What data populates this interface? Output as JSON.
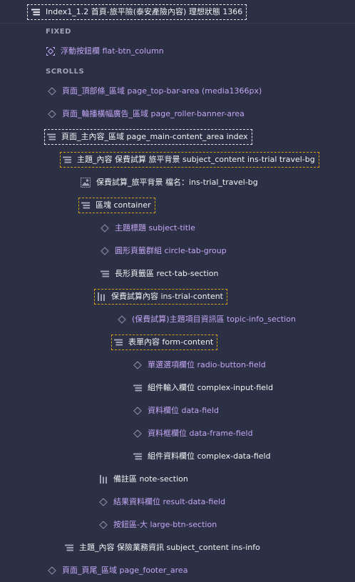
{
  "root": {
    "label": "Index1_1.2 首頁-旅平險(泰安產險內容) 理想狀態 1366"
  },
  "sections": {
    "fixed": "FIXED",
    "scrolls": "SCROLLS"
  },
  "layers": [
    {
      "label": "浮動按鈕欄 flat-btn_column",
      "icon": "frame-icon",
      "style": "purple"
    },
    {
      "label": "頁面_頂部條_區域 page_top-bar-area (media1366px)",
      "icon": "component-diamond-icon",
      "style": "purple"
    },
    {
      "label": "頁面_輪播橫幅廣告_區域 page_roller-banner-area",
      "icon": "component-diamond-icon",
      "style": "purple"
    },
    {
      "label": "頁面_主內容_區域 page_main-content_area index",
      "icon": "stack-vertical-icon",
      "style": "white"
    },
    {
      "label": "主題_內容 保費試算 旅平背景 subject_content ins-trial travel-bg",
      "icon": "stack-vertical-icon",
      "style": "white"
    },
    {
      "label": "保費試算_旅平背景 檔名：ins-trial_travel-bg",
      "icon": "image-icon",
      "style": "white"
    },
    {
      "label": "區塊 container",
      "icon": "stack-vertical-icon",
      "style": "white"
    },
    {
      "label": "主題標題 subject-title",
      "icon": "component-diamond-icon",
      "style": "purple"
    },
    {
      "label": "圓形頁籤群組 circle-tab-group",
      "icon": "component-diamond-icon",
      "style": "purple"
    },
    {
      "label": "長形頁籤區 rect-tab-section",
      "icon": "stack-vertical-icon",
      "style": "white"
    },
    {
      "label": "保費試算內容 ins-trial-content",
      "icon": "stack-horizontal-icon",
      "style": "white"
    },
    {
      "label": "(保費試算)主題項目資訊區 topic-info_section",
      "icon": "component-diamond-icon",
      "style": "purple"
    },
    {
      "label": "表單內容 form-content",
      "icon": "stack-vertical-icon",
      "style": "white"
    },
    {
      "label": "單選選項欄位 radio-button-field",
      "icon": "component-diamond-icon",
      "style": "purple"
    },
    {
      "label": "組件輸入欄位 complex-input-field",
      "icon": "stack-vertical-icon",
      "style": "white"
    },
    {
      "label": "資料欄位 data-field",
      "icon": "component-diamond-icon",
      "style": "purple"
    },
    {
      "label": "資料框欄位 data-frame-field",
      "icon": "component-diamond-icon",
      "style": "purple"
    },
    {
      "label": "組件資料欄位 complex-data-field",
      "icon": "stack-vertical-icon",
      "style": "white"
    },
    {
      "label": "備註區 note-section",
      "icon": "stack-horizontal-icon",
      "style": "white"
    },
    {
      "label": "結果資料欄位 result-data-field",
      "icon": "component-diamond-icon",
      "style": "purple"
    },
    {
      "label": "按鈕區-大 large-btn-section",
      "icon": "component-diamond-icon",
      "style": "purple"
    },
    {
      "label": "主題_內容 保險業務資訊 subject_content ins-info",
      "icon": "stack-vertical-icon",
      "style": "white"
    },
    {
      "label": "頁面_頁尾_區域 page_footer_area",
      "icon": "component-diamond-icon",
      "style": "purple"
    }
  ]
}
